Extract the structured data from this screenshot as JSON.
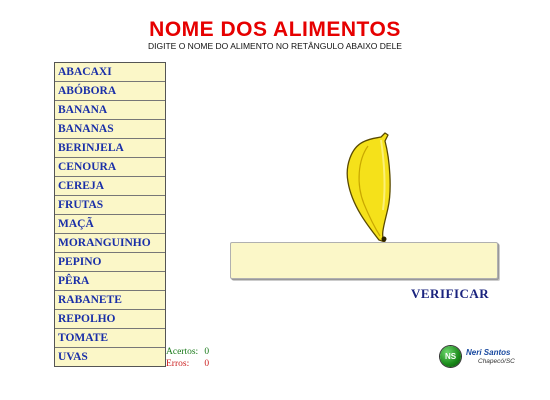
{
  "header": {
    "title": "NOME DOS ALIMENTOS",
    "subtitle": "DIGITE O NOME DO ALIMENTO NO RETÂNGULO ABAIXO DELE"
  },
  "foods": [
    "ABACAXI",
    "ABÓBORA",
    "BANANA",
    "BANANAS",
    "BERINJELA",
    "CENOURA",
    "CEREJA",
    "FRUTAS",
    "MAÇÃ",
    "MORANGUINHO",
    "PEPINO",
    "PÊRA",
    "RABANETE",
    "REPOLHO",
    "TOMATE",
    "UVAS"
  ],
  "image": {
    "icon": "banana"
  },
  "answer": {
    "value": "",
    "placeholder": ""
  },
  "actions": {
    "verify_label": "VERIFICAR"
  },
  "score": {
    "acertos_label": "Acertos:",
    "acertos_value": "0",
    "erros_label": "Erros:",
    "erros_value": "0"
  },
  "logo": {
    "initials": "NS",
    "name": "Neri Santos",
    "place": "Chapecó/SC"
  },
  "colors": {
    "title": "#e60000",
    "word_text": "#1a2fa8",
    "panel_bg": "#fbf7c8",
    "acertos": "#1a7a1a",
    "erros": "#cc2222"
  }
}
